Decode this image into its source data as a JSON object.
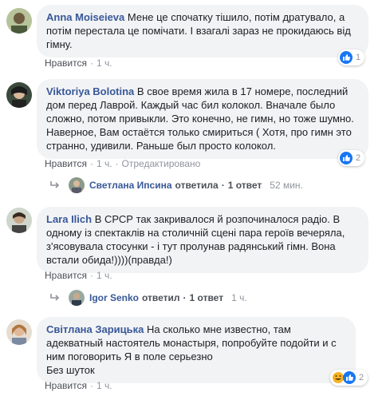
{
  "comments": [
    {
      "author": "Anna Moiseieva",
      "text": "Мене це спочатку тішило, потім дратувало, а потім перестала це помічати. І взагалі зараз не прокидаюсь від гімну.",
      "like": "Нравится",
      "time": "1 ч.",
      "edited": "",
      "reactions": "1"
    },
    {
      "author": "Viktoriya Bolotina",
      "text": "В свое время жила в 17 номере, последний дом перед Лаврой. Каждый час бил колокол. Вначале было сложно, потом привыкли. Это конечно, не гимн, но тоже шумно. Наверное, Вам остаётся только смириться ( Хотя, про гимн это странно, удивили. Раньше был просто колокол.",
      "like": "Нравится",
      "time": "1 ч.",
      "edited": "Отредактировано",
      "reactions": "2",
      "reply": {
        "name": "Светлана Ипсина",
        "action": "ответила",
        "count": "1 ответ",
        "time": "52 мин."
      }
    },
    {
      "author": "Lara Ilich",
      "text": "В СРСР так закривалося й розпочиналося радіо. В одному із спектаклів на столичній сцені пара героїв вечеряла, з'ясовувала стосунки - і тут пролунав радянський гімн. Вона встали обида!))))(правда!)",
      "like": "Нравится",
      "time": "1 ч.",
      "reply": {
        "name": "Igor Senko",
        "action": "ответил",
        "count": "1 ответ",
        "time": "1 ч."
      }
    },
    {
      "author": "Світлана Зарицька",
      "text": "На сколько мне известно, там адекватный настоятель монастыря, попробуйте подойти и с ним поговорить Я в поле серьезно\nБез шуток",
      "like": "Нравится",
      "time": "1 ч.",
      "reactions": "2"
    }
  ],
  "colors": {
    "author": "#385898",
    "bubble": "#f2f3f5",
    "like": "#1877f2",
    "haha": "#f7b125"
  },
  "icons": [
    "like-reaction-icon",
    "haha-reaction-icon",
    "reply-arrow-icon"
  ]
}
